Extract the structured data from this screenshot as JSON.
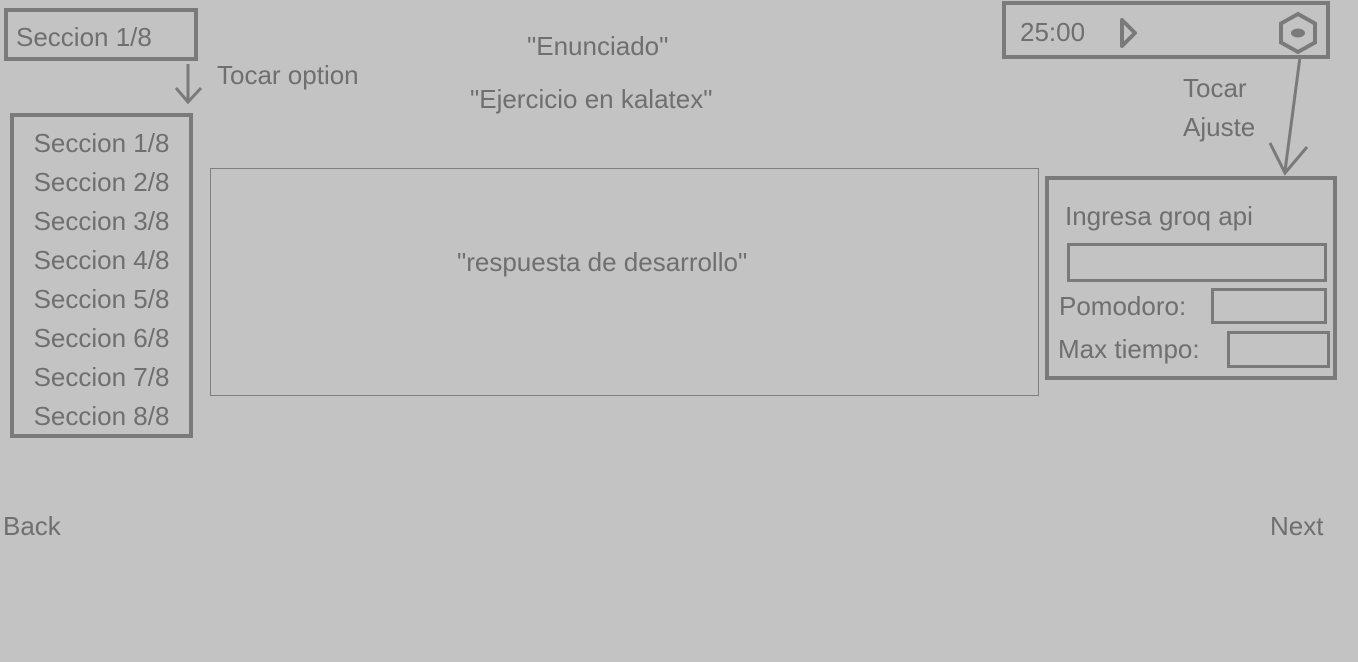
{
  "section_selector": {
    "current_label": "Seccion 1/8",
    "hint": "Tocar option",
    "options": [
      "Seccion 1/8",
      "Seccion 2/8",
      "Seccion 3/8",
      "Seccion 4/8",
      "Seccion 5/8",
      "Seccion 6/8",
      "Seccion 7/8",
      "Seccion 8/8"
    ]
  },
  "exercise": {
    "statement": "\"Enunciado\"",
    "latex": "\"Ejercicio en kalatex\"",
    "answer_placeholder": "\"respuesta de desarrollo\""
  },
  "timer": {
    "time": "25:00",
    "play_icon": "play-icon",
    "settings_icon": "gear-icon"
  },
  "settings": {
    "hint_line1": "Tocar",
    "hint_line2": "Ajuste",
    "api_label": "Ingresa groq api",
    "api_value": "",
    "pomodoro_label": "Pomodoro:",
    "pomodoro_value": "",
    "max_time_label": "Max tiempo:",
    "max_time_value": ""
  },
  "navigation": {
    "back_label": "Back",
    "next_label": "Next"
  },
  "colors": {
    "background": "#c3c3c3",
    "stroke": "#7a7a7a",
    "text": "#6f6f6f"
  }
}
